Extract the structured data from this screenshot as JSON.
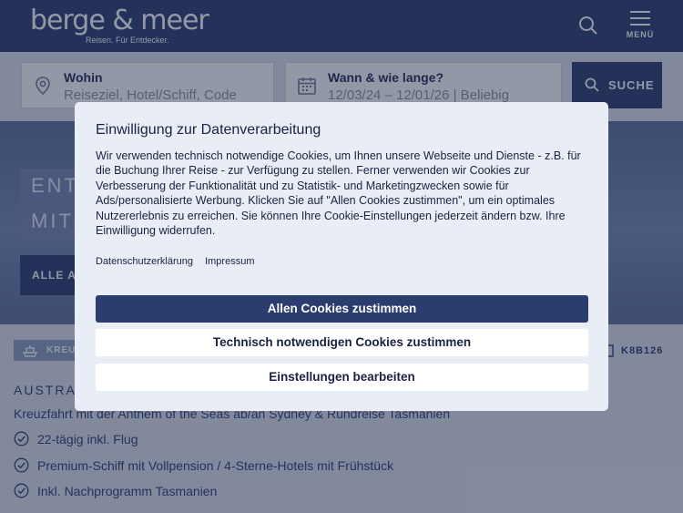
{
  "header": {
    "logo_text": "berge & meer",
    "logo_tagline": "Reisen. Für Entdecker.",
    "menu_label": "MENÜ"
  },
  "search": {
    "where_label": "Wohin",
    "where_value": "Reiseziel, Hotel/Schiff, Code",
    "when_label": "Wann & wie lange?",
    "when_value": "12/03/24 – 12/01/26 | Beliebig",
    "button_label": "SUCHE"
  },
  "hero": {
    "line1": "ENT",
    "line2": "MIT",
    "button_label": "ALLE A"
  },
  "offer": {
    "badge": "KREU",
    "code": "K8B126",
    "destination": "AUSTRAL",
    "subtitle": "Kreuzfahrt mit der Anthem of the Seas ab/an Sydney & Rundreise Tasmanien",
    "features": [
      "22-tägig inkl. Flug",
      "Premium-Schiff mit Vollpension / 4-Sterne-Hotels mit Frühstück",
      "Inkl. Nachprogramm Tasmanien"
    ]
  },
  "consent": {
    "title": "Einwilligung zur Datenverarbeitung",
    "text": "Wir verwenden technisch notwendige Cookies, um Ihnen unsere Webseite und Dienste - z.B. für die Buchung Ihrer Reise - zur Verfügung zu stellen. Ferner verwenden wir Cookies zur Verbesserung der Funktionalität und zu Statistik- und Marketingzwecken sowie für Ads/personalisierte Werbung. Klicken Sie auf \"Allen Cookies zustimmen\", um ein optimales Nutzererlebnis zu erreichen. Sie können Ihre Cookie-Einstellungen jederzeit ändern bzw. Ihre Einwilligung widerrufen.",
    "link_privacy": "Datenschutzerklärung",
    "link_imprint": "Impressum",
    "btn_accept_all": "Allen Cookies zustimmen",
    "btn_necessary": "Technisch notwendigen Cookies zustimmen",
    "btn_settings": "Einstellungen bearbeiten"
  },
  "colors": {
    "brand": "#2b3c6e",
    "background": "#dfe3ee",
    "modal": "#e9edf5"
  }
}
